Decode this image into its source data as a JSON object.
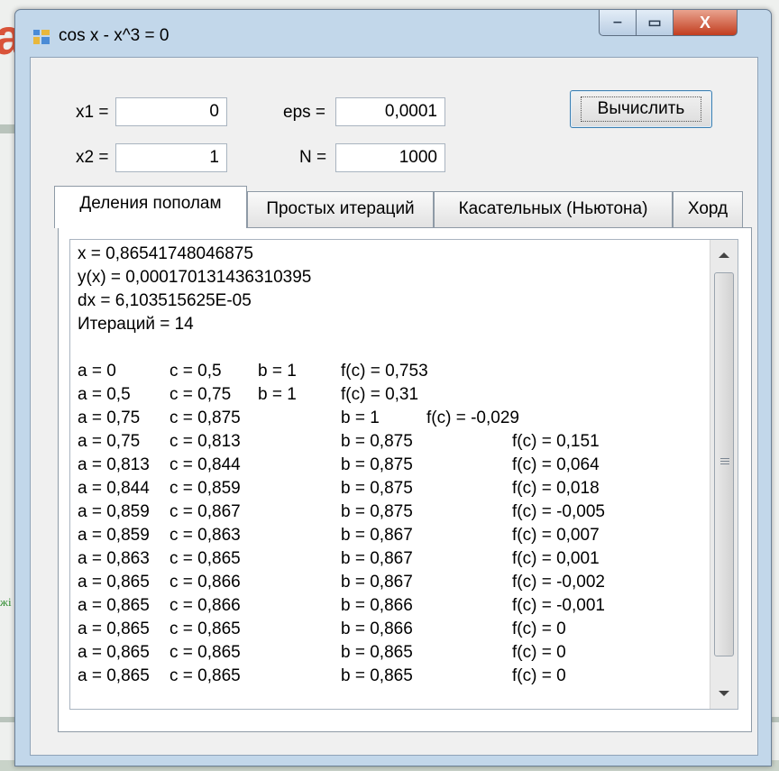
{
  "background": {
    "heading_fragment": "a",
    "green_fragment": "жі"
  },
  "window": {
    "title": "cos x - x^3 = 0",
    "controls": {
      "minimize": "‒",
      "maximize": "▭",
      "close": "X"
    }
  },
  "inputs": {
    "x1": {
      "label": "x1 =",
      "value": "0"
    },
    "x2": {
      "label": "x2 =",
      "value": "1"
    },
    "eps": {
      "label": "eps =",
      "value": "0,0001"
    },
    "n": {
      "label": "N =",
      "value": "1000"
    }
  },
  "compute_button": "Вычислить",
  "tabs": [
    {
      "label": "Деления пополам",
      "active": true
    },
    {
      "label": "Простых итераций",
      "active": false
    },
    {
      "label": "Касательных (Ньютона)",
      "active": false
    },
    {
      "label": "Хорд",
      "active": false
    }
  ],
  "output": {
    "summary": [
      "x = 0,86541748046875",
      "y(x) = 0,000170131436310395",
      "dx = 6,103515625E-05",
      "Итераций = 14"
    ],
    "rows": [
      {
        "a": "a = 0",
        "c": "c = 0,5",
        "b": "b = 1",
        "f": "f(c) = 0,753"
      },
      {
        "a": "a = 0,5",
        "c": "c = 0,75",
        "b": "b = 1",
        "f": "f(c) = 0,31"
      },
      {
        "a": "a = 0,75",
        "c": "c = 0,875",
        "b": "b = 1",
        "f": "f(c) = -0,029"
      },
      {
        "a": "a = 0,75",
        "c": "c = 0,813",
        "b": "b = 0,875",
        "f": "f(c) = 0,151"
      },
      {
        "a": "a = 0,813",
        "c": "c = 0,844",
        "b": "b = 0,875",
        "f": "f(c) = 0,064"
      },
      {
        "a": "a = 0,844",
        "c": "c = 0,859",
        "b": "b = 0,875",
        "f": "f(c) = 0,018"
      },
      {
        "a": "a = 0,859",
        "c": "c = 0,867",
        "b": "b = 0,875",
        "f": "f(c) = -0,005"
      },
      {
        "a": "a = 0,859",
        "c": "c = 0,863",
        "b": "b = 0,867",
        "f": "f(c) = 0,007"
      },
      {
        "a": "a = 0,863",
        "c": "c = 0,865",
        "b": "b = 0,867",
        "f": "f(c) = 0,001"
      },
      {
        "a": "a = 0,865",
        "c": "c = 0,866",
        "b": "b = 0,867",
        "f": "f(c) = -0,002"
      },
      {
        "a": "a = 0,865",
        "c": "c = 0,866",
        "b": "b = 0,866",
        "f": "f(c) = -0,001"
      },
      {
        "a": "a = 0,865",
        "c": "c = 0,865",
        "b": "b = 0,866",
        "f": "f(c) = 0"
      },
      {
        "a": "a = 0,865",
        "c": "c = 0,865",
        "b": "b = 0,865",
        "f": "f(c) = 0"
      },
      {
        "a": "a = 0,865",
        "c": "c = 0,865",
        "b": "b = 0,865",
        "f": "f(c) = 0"
      }
    ]
  },
  "icons": {
    "app": "app-window-icon",
    "scroll_up": "scroll-up-arrow-icon",
    "scroll_down": "scroll-down-arrow-icon",
    "scroll_grip": "scroll-grip-icon"
  },
  "colors": {
    "window_frame": "#c2d7ea",
    "close_button": "#c23d1f",
    "button_border": "#3c7fb1",
    "background_heading": "#d9543a"
  }
}
